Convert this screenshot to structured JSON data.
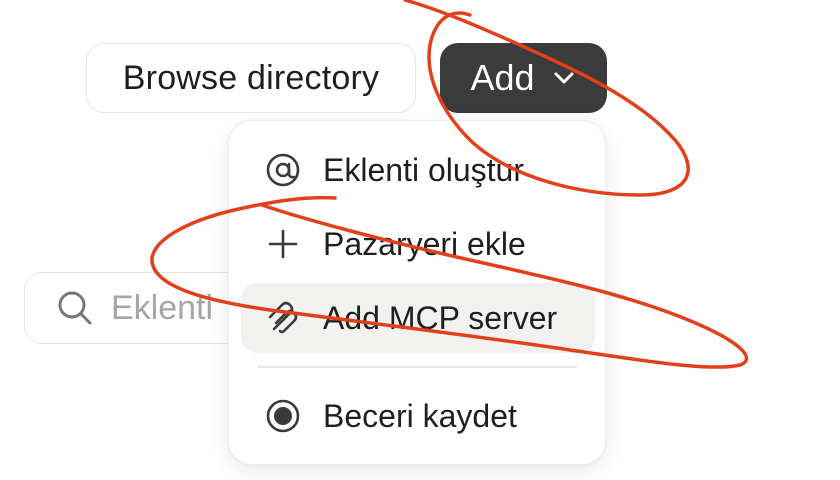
{
  "toolbar": {
    "browse_label": "Browse directory",
    "add_label": "Add"
  },
  "search": {
    "placeholder": "Eklenti"
  },
  "menu": {
    "items": [
      {
        "label": "Eklenti oluştur",
        "icon": "at-icon"
      },
      {
        "label": "Pazaryeri ekle",
        "icon": "plus-icon"
      },
      {
        "label": "Add MCP server",
        "icon": "mcp-icon"
      },
      {
        "label": "Beceri kaydet",
        "icon": "radio-icon"
      }
    ]
  },
  "colors": {
    "add_button_bg": "#3b3b3b",
    "hover_bg": "#f1f1f0",
    "annotation": "#e2401c"
  }
}
